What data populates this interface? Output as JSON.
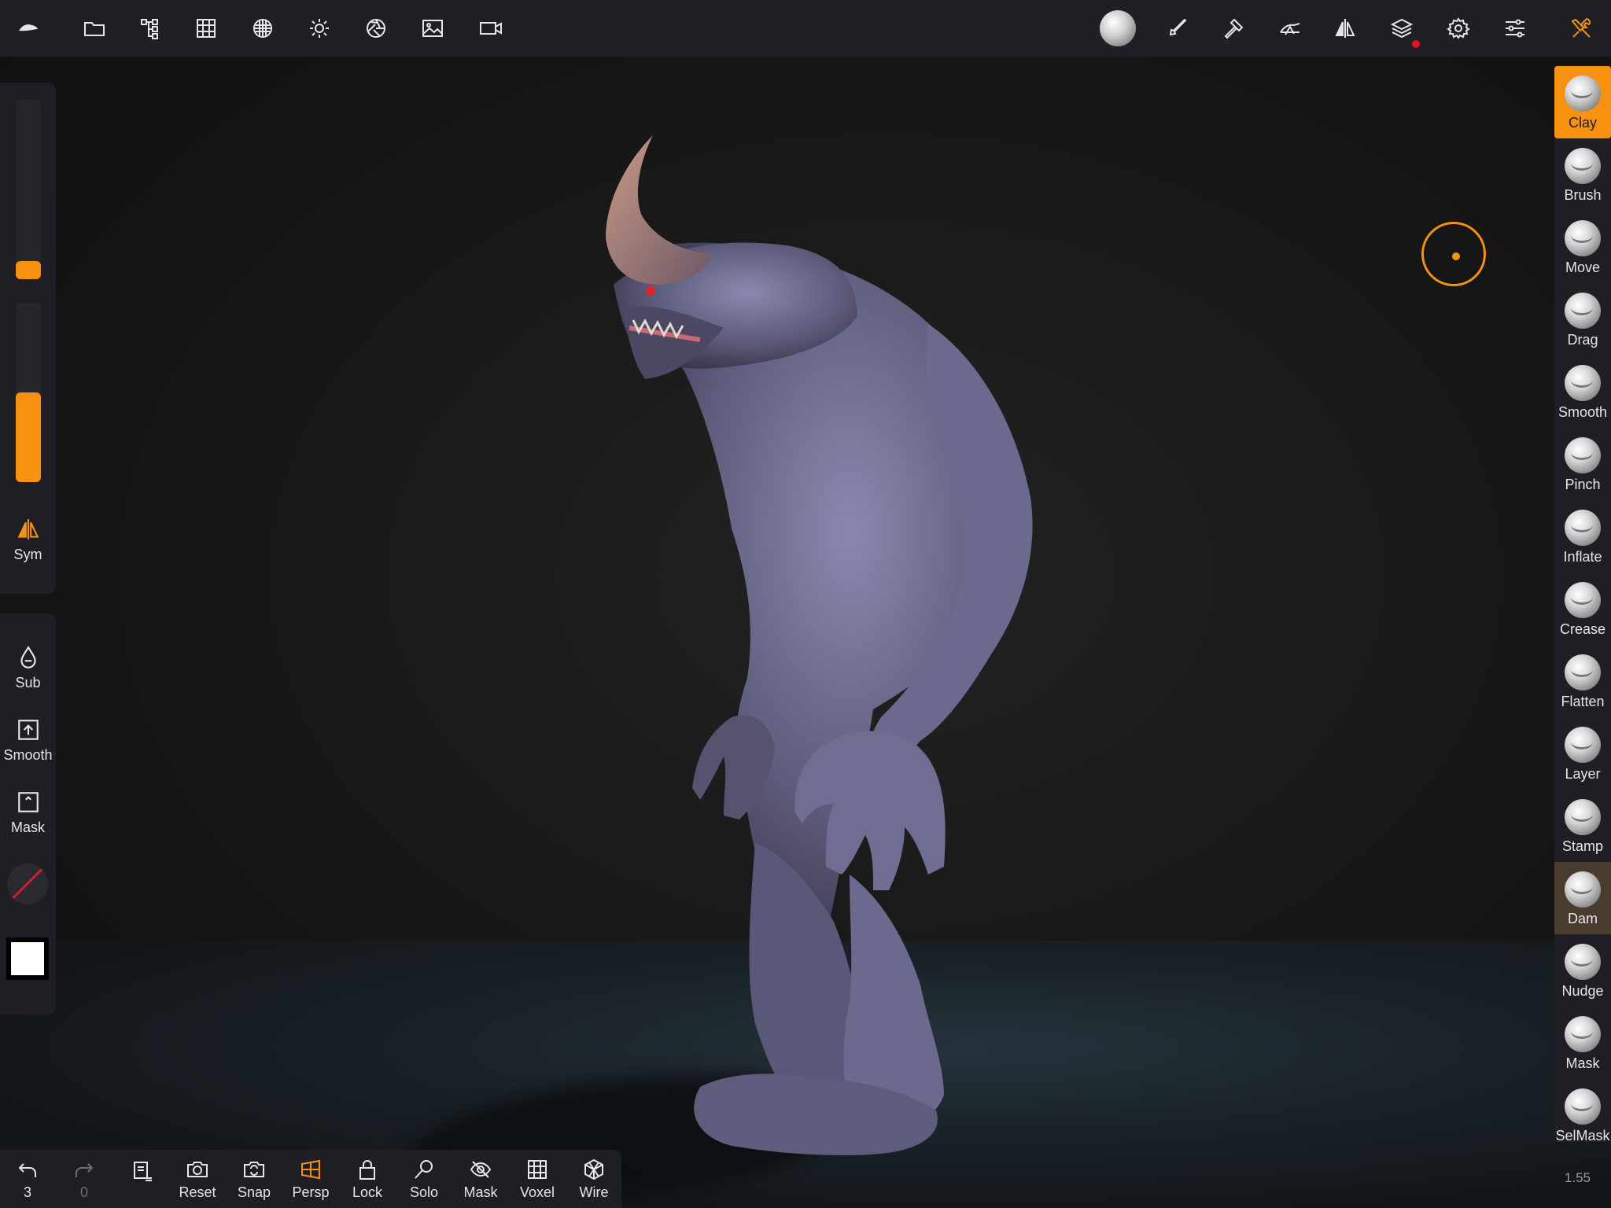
{
  "top_toolbar": {
    "left_icons": [
      "nomad-logo-icon",
      "folder-icon",
      "scene-tree-icon",
      "grid-icon",
      "material-sphere-icon",
      "light-icon",
      "camera-aperture-icon",
      "image-icon",
      "video-icon"
    ],
    "right_icons": [
      "matcap-sphere-icon",
      "paint-brush-icon",
      "hammer-icon",
      "topology-icon",
      "symmetry-icon",
      "layers-icon",
      "settings-gear-icon",
      "sliders-icon",
      "tools-icon"
    ]
  },
  "left_panel": {
    "sym_label": "Sym",
    "sub_label": "Sub",
    "smooth_label": "Smooth",
    "mask_label": "Mask",
    "radius_level": 0.1,
    "intensity_level": 0.5
  },
  "tools": {
    "items": [
      {
        "label": "Clay"
      },
      {
        "label": "Brush"
      },
      {
        "label": "Move"
      },
      {
        "label": "Drag"
      },
      {
        "label": "Smooth"
      },
      {
        "label": "Pinch"
      },
      {
        "label": "Inflate"
      },
      {
        "label": "Crease"
      },
      {
        "label": "Flatten"
      },
      {
        "label": "Layer"
      },
      {
        "label": "Stamp"
      },
      {
        "label": "Dam"
      },
      {
        "label": "Nudge"
      },
      {
        "label": "Mask"
      },
      {
        "label": "SelMask"
      }
    ],
    "active": "Clay"
  },
  "bottom_toolbar": {
    "undo_count": "3",
    "redo_count": "0",
    "reset_label": "Reset",
    "snap_label": "Snap",
    "persp_label": "Persp",
    "lock_label": "Lock",
    "solo_label": "Solo",
    "mask_label": "Mask",
    "voxel_label": "Voxel",
    "wire_label": "Wire"
  },
  "zoom_readout": "1.55",
  "colors": {
    "accent": "#f7910f",
    "panel": "#1e1e24",
    "notification": "#e0141e"
  }
}
